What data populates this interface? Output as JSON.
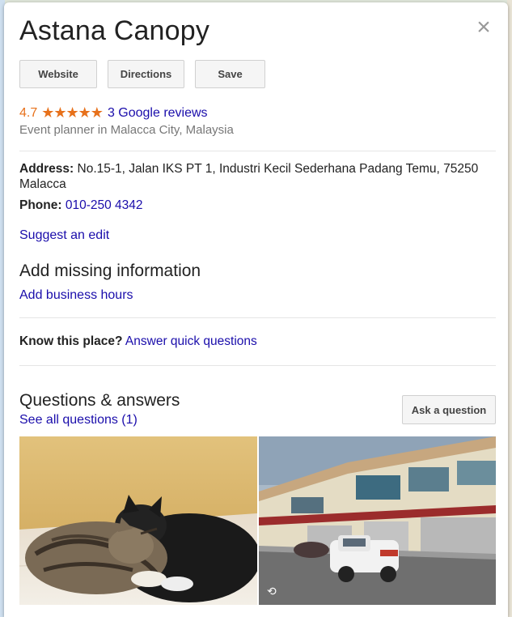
{
  "place": {
    "name": "Astana Canopy",
    "rating": "4.7",
    "stars": "★★★★★",
    "reviews_link": "3 Google reviews",
    "category": "Event planner in Malacca City, Malaysia"
  },
  "buttons": {
    "website": "Website",
    "directions": "Directions",
    "save": "Save",
    "close": "×"
  },
  "details": {
    "address_label": "Address:",
    "address_value": "No.15-1, Jalan IKS PT 1, Industri Kecil Sederhana Padang Temu, 75250 Malacca",
    "phone_label": "Phone:",
    "phone_value": "010-250 4342",
    "suggest_edit": "Suggest an edit"
  },
  "missing": {
    "heading": "Add missing information",
    "add_hours": "Add business hours"
  },
  "know": {
    "label": "Know this place?",
    "link": "Answer quick questions"
  },
  "qa": {
    "heading": "Questions & answers",
    "see_all": "See all questions (1)",
    "ask_button": "Ask a question"
  },
  "photos": [
    {
      "subject": "two cats sleeping on a tiled floor"
    },
    {
      "subject": "street view of shophouses with parked pickup truck",
      "icon": "street-view-360-icon"
    }
  ],
  "colors": {
    "link": "#1a0dab",
    "rating": "#e7711b"
  }
}
